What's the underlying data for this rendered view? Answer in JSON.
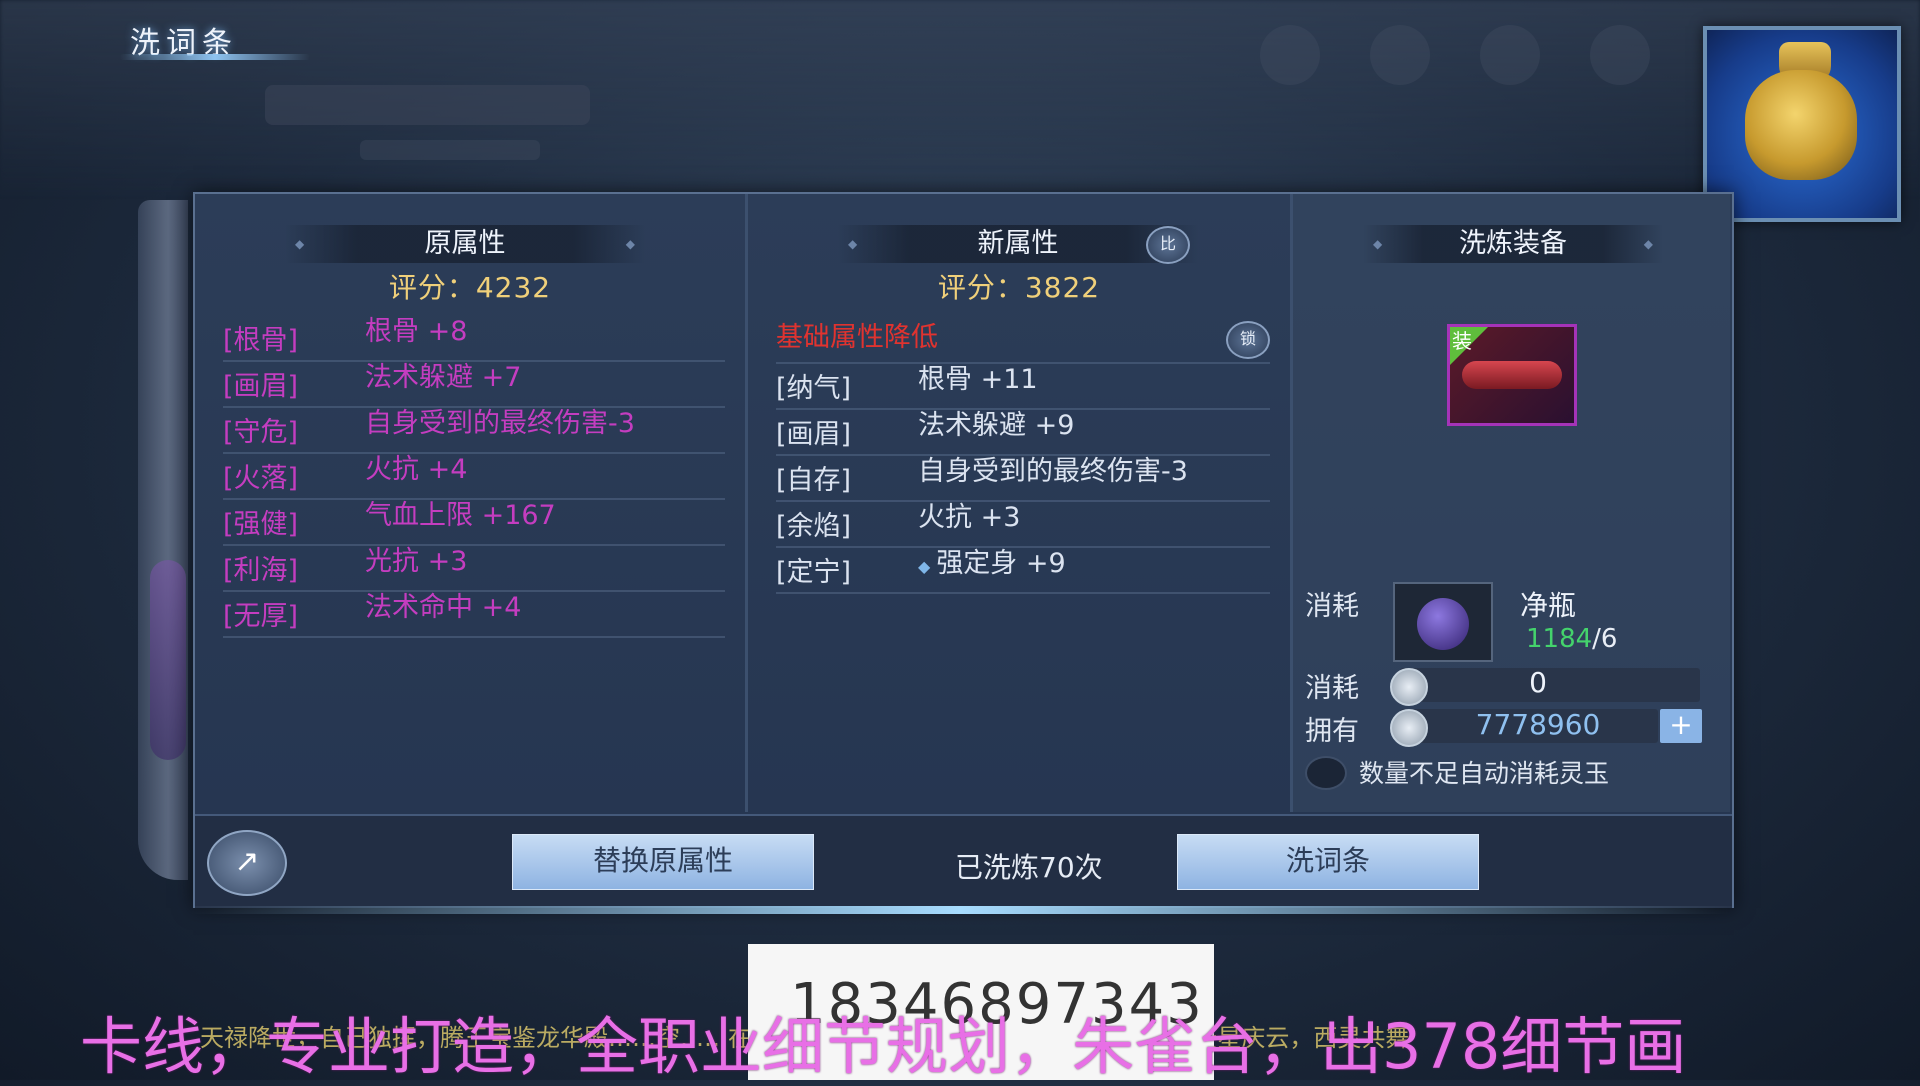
{
  "window": {
    "title": "洗词条"
  },
  "old_attrs": {
    "header": "原属性",
    "score": "评分：4232",
    "rows": [
      {
        "tag": "[根骨]",
        "value": "根骨 +8"
      },
      {
        "tag": "[画眉]",
        "value": "法术躲避 +7"
      },
      {
        "tag": "[守危]",
        "value": "自身受到的最终伤害-3"
      },
      {
        "tag": "[火落]",
        "value": "火抗 +4"
      },
      {
        "tag": "[强健]",
        "value": "气血上限 +167"
      },
      {
        "tag": "[利海]",
        "value": "光抗 +3"
      },
      {
        "tag": "[无厚]",
        "value": "法术命中 +4"
      }
    ]
  },
  "new_attrs": {
    "header": "新属性",
    "score": "评分：3822",
    "compare_button": "比",
    "warning": "基础属性降低",
    "lock_button": "锁",
    "rows": [
      {
        "tag": "[纳气]",
        "value": "根骨 +11"
      },
      {
        "tag": "[画眉]",
        "value": "法术躲避 +9"
      },
      {
        "tag": "[自存]",
        "value": "自身受到的最终伤害-3"
      },
      {
        "tag": "[余焰]",
        "value": "火抗 +3"
      },
      {
        "tag": "[定宁]",
        "value": "强定身 +9",
        "mark": "◆"
      }
    ]
  },
  "equip": {
    "header": "洗炼装备",
    "slot_tag": "装",
    "cost_label": "消耗",
    "item_name": "净瓶",
    "item_have": "1184",
    "item_need": "/6",
    "coin_cost_label": "消耗",
    "coin_cost": "0",
    "own_label": "拥有",
    "own_amount": "7778960",
    "plus": "+",
    "auto_text": "数量不足自动消耗灵玉"
  },
  "bottom": {
    "share_icon": "↗",
    "replace_button": "替换原属性",
    "wash_count": "已洗炼70次",
    "wash_button": "洗词条"
  },
  "overlay": {
    "phone": "18346897343",
    "marquee": "卡线，专业打造，全职业细节规划，朱雀台，出378细节画",
    "chat": "天禄降世，自己独挥，腾王宝鉴龙华殿……空……在……中捧出……豪……世天衣锦盒]，正是景星庆云，西灵共舞"
  }
}
